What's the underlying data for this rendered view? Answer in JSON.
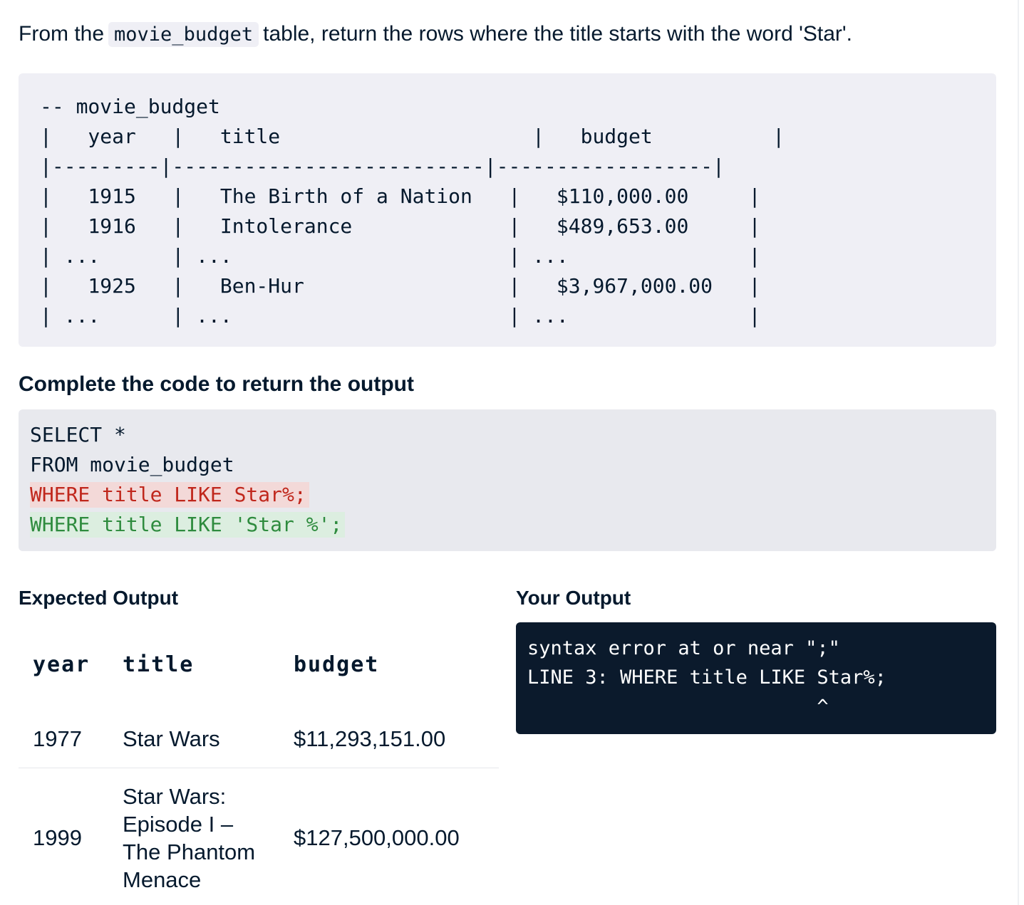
{
  "prompt": {
    "before": "From the",
    "table_name": "movie_budget",
    "after": "table, return the rows where the title starts with the word 'Star'."
  },
  "schema": {
    "lines": [
      "-- movie_budget",
      "|   year   |   title                     |   budget          |",
      "|---------|--------------------------|------------------|",
      "|   1915   |   The Birth of a Nation   |   $110,000.00     |",
      "|   1916   |   Intolerance             |   $489,653.00     |",
      "| ...      | ...                       | ...               |",
      "|   1925   |   Ben-Hur                 |   $3,967,000.00   |",
      "| ...      | ...                       | ...               |"
    ]
  },
  "task_title": "Complete the code to return the output",
  "code": {
    "line1": "SELECT *",
    "line2": "FROM movie_budget",
    "removed_line": "WHERE title LIKE Star%;",
    "added_line": "WHERE title LIKE 'Star %';"
  },
  "expected_output": {
    "heading": "Expected Output",
    "columns": [
      "year",
      "title",
      "budget"
    ],
    "rows": [
      {
        "year": "1977",
        "title": "Star Wars",
        "budget": "$11,293,151.00"
      },
      {
        "year": "1999",
        "title": "Star Wars: Episode I – The Phantom Menace",
        "budget": "$127,500,000.00"
      }
    ]
  },
  "your_output": {
    "heading": "Your Output",
    "error_line1": "syntax error at or near \";\"",
    "error_line2": "LINE 3: WHERE title LIKE Star%;",
    "error_line3": "                         ^"
  },
  "colors": {
    "text": "#05192d",
    "code_bg": "#e8e9ee",
    "schema_bg": "#efeff5",
    "removed_fg": "#c0271c",
    "removed_bg": "#f3d9d8",
    "added_fg": "#2e8b3e",
    "added_bg": "#dceee0",
    "error_bg": "#0b1a2c"
  }
}
